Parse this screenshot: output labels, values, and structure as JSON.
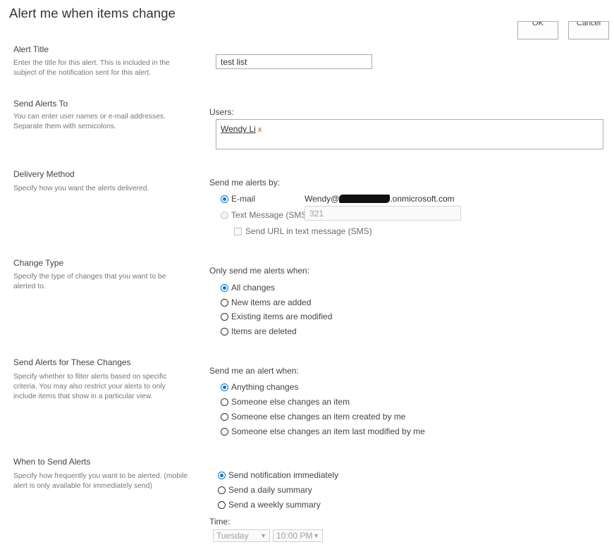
{
  "page": {
    "title": "Alert me when items change"
  },
  "buttons": {
    "ok_label": "OK",
    "cancel_label": "Cancel"
  },
  "sections": {
    "alert_title": {
      "title": "Alert Title",
      "description": "Enter the title for this alert. This is included in the subject of the notification sent for this alert.",
      "value": "test list"
    },
    "send_alerts_to": {
      "title": "Send Alerts To",
      "description": "You can enter user names or e-mail addresses. Separate them with semicolons.",
      "users_label": "Users:",
      "users": [
        {
          "name": "Wendy Li",
          "remove": "x"
        }
      ]
    },
    "delivery_method": {
      "title": "Delivery Method",
      "description": "Specify how you want the alerts delivered.",
      "prompt": "Send me alerts by:",
      "email_label": "E-mail",
      "email_prefix": "Wendy@",
      "email_suffix": ".onmicrosoft.com",
      "sms_label": "Text Message (SMS)",
      "sms_value": "321",
      "send_url_label": "Send URL in text message (SMS)"
    },
    "change_type": {
      "title": "Change Type",
      "description": "Specify the type of changes that you want to be alerted to.",
      "prompt": "Only send me alerts when:",
      "options": [
        "All changes",
        "New items are added",
        "Existing items are modified",
        "Items are deleted"
      ],
      "selected": "All changes"
    },
    "filter": {
      "title": "Send Alerts for These Changes",
      "description": "Specify whether to filter alerts based on specific criteria. You may also restrict your alerts to only include items that show in a particular view.",
      "prompt": "Send me an alert when:",
      "options": [
        "Anything changes",
        "Someone else changes an item",
        "Someone else changes an item created by me",
        "Someone else changes an item last modified by me"
      ],
      "selected": "Anything changes"
    },
    "when": {
      "title": "When to Send Alerts",
      "description": "Specify how frequently you want to be alerted. (mobile alert is only available for immediately send)",
      "options": [
        "Send notification immediately",
        "Send a daily summary",
        "Send a weekly summary"
      ],
      "selected": "Send notification immediately",
      "time_label": "Time:",
      "day_value": "Tuesday",
      "time_value": "10:00 PM"
    }
  },
  "colors": {
    "accent": "#0078d4",
    "remove_x": "#c55a11"
  }
}
